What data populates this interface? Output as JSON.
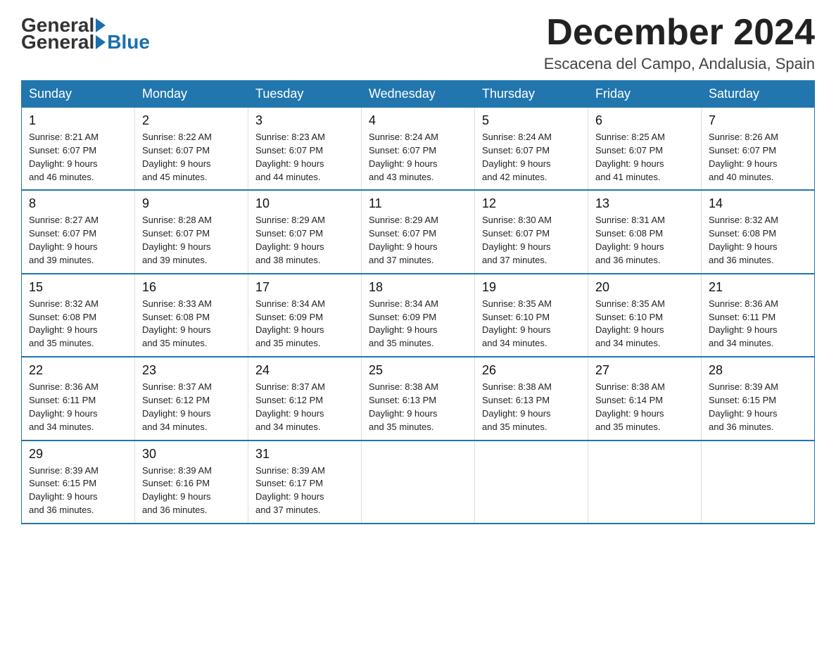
{
  "logo": {
    "general": "General",
    "blue": "Blue"
  },
  "title": "December 2024",
  "location": "Escacena del Campo, Andalusia, Spain",
  "days_of_week": [
    "Sunday",
    "Monday",
    "Tuesday",
    "Wednesday",
    "Thursday",
    "Friday",
    "Saturday"
  ],
  "weeks": [
    [
      {
        "day": "1",
        "sunrise": "8:21 AM",
        "sunset": "6:07 PM",
        "daylight": "9 hours and 46 minutes."
      },
      {
        "day": "2",
        "sunrise": "8:22 AM",
        "sunset": "6:07 PM",
        "daylight": "9 hours and 45 minutes."
      },
      {
        "day": "3",
        "sunrise": "8:23 AM",
        "sunset": "6:07 PM",
        "daylight": "9 hours and 44 minutes."
      },
      {
        "day": "4",
        "sunrise": "8:24 AM",
        "sunset": "6:07 PM",
        "daylight": "9 hours and 43 minutes."
      },
      {
        "day": "5",
        "sunrise": "8:24 AM",
        "sunset": "6:07 PM",
        "daylight": "9 hours and 42 minutes."
      },
      {
        "day": "6",
        "sunrise": "8:25 AM",
        "sunset": "6:07 PM",
        "daylight": "9 hours and 41 minutes."
      },
      {
        "day": "7",
        "sunrise": "8:26 AM",
        "sunset": "6:07 PM",
        "daylight": "9 hours and 40 minutes."
      }
    ],
    [
      {
        "day": "8",
        "sunrise": "8:27 AM",
        "sunset": "6:07 PM",
        "daylight": "9 hours and 39 minutes."
      },
      {
        "day": "9",
        "sunrise": "8:28 AM",
        "sunset": "6:07 PM",
        "daylight": "9 hours and 39 minutes."
      },
      {
        "day": "10",
        "sunrise": "8:29 AM",
        "sunset": "6:07 PM",
        "daylight": "9 hours and 38 minutes."
      },
      {
        "day": "11",
        "sunrise": "8:29 AM",
        "sunset": "6:07 PM",
        "daylight": "9 hours and 37 minutes."
      },
      {
        "day": "12",
        "sunrise": "8:30 AM",
        "sunset": "6:07 PM",
        "daylight": "9 hours and 37 minutes."
      },
      {
        "day": "13",
        "sunrise": "8:31 AM",
        "sunset": "6:08 PM",
        "daylight": "9 hours and 36 minutes."
      },
      {
        "day": "14",
        "sunrise": "8:32 AM",
        "sunset": "6:08 PM",
        "daylight": "9 hours and 36 minutes."
      }
    ],
    [
      {
        "day": "15",
        "sunrise": "8:32 AM",
        "sunset": "6:08 PM",
        "daylight": "9 hours and 35 minutes."
      },
      {
        "day": "16",
        "sunrise": "8:33 AM",
        "sunset": "6:08 PM",
        "daylight": "9 hours and 35 minutes."
      },
      {
        "day": "17",
        "sunrise": "8:34 AM",
        "sunset": "6:09 PM",
        "daylight": "9 hours and 35 minutes."
      },
      {
        "day": "18",
        "sunrise": "8:34 AM",
        "sunset": "6:09 PM",
        "daylight": "9 hours and 35 minutes."
      },
      {
        "day": "19",
        "sunrise": "8:35 AM",
        "sunset": "6:10 PM",
        "daylight": "9 hours and 34 minutes."
      },
      {
        "day": "20",
        "sunrise": "8:35 AM",
        "sunset": "6:10 PM",
        "daylight": "9 hours and 34 minutes."
      },
      {
        "day": "21",
        "sunrise": "8:36 AM",
        "sunset": "6:11 PM",
        "daylight": "9 hours and 34 minutes."
      }
    ],
    [
      {
        "day": "22",
        "sunrise": "8:36 AM",
        "sunset": "6:11 PM",
        "daylight": "9 hours and 34 minutes."
      },
      {
        "day": "23",
        "sunrise": "8:37 AM",
        "sunset": "6:12 PM",
        "daylight": "9 hours and 34 minutes."
      },
      {
        "day": "24",
        "sunrise": "8:37 AM",
        "sunset": "6:12 PM",
        "daylight": "9 hours and 34 minutes."
      },
      {
        "day": "25",
        "sunrise": "8:38 AM",
        "sunset": "6:13 PM",
        "daylight": "9 hours and 35 minutes."
      },
      {
        "day": "26",
        "sunrise": "8:38 AM",
        "sunset": "6:13 PM",
        "daylight": "9 hours and 35 minutes."
      },
      {
        "day": "27",
        "sunrise": "8:38 AM",
        "sunset": "6:14 PM",
        "daylight": "9 hours and 35 minutes."
      },
      {
        "day": "28",
        "sunrise": "8:39 AM",
        "sunset": "6:15 PM",
        "daylight": "9 hours and 36 minutes."
      }
    ],
    [
      {
        "day": "29",
        "sunrise": "8:39 AM",
        "sunset": "6:15 PM",
        "daylight": "9 hours and 36 minutes."
      },
      {
        "day": "30",
        "sunrise": "8:39 AM",
        "sunset": "6:16 PM",
        "daylight": "9 hours and 36 minutes."
      },
      {
        "day": "31",
        "sunrise": "8:39 AM",
        "sunset": "6:17 PM",
        "daylight": "9 hours and 37 minutes."
      },
      null,
      null,
      null,
      null
    ]
  ],
  "labels": {
    "sunrise": "Sunrise:",
    "sunset": "Sunset:",
    "daylight": "Daylight:"
  }
}
